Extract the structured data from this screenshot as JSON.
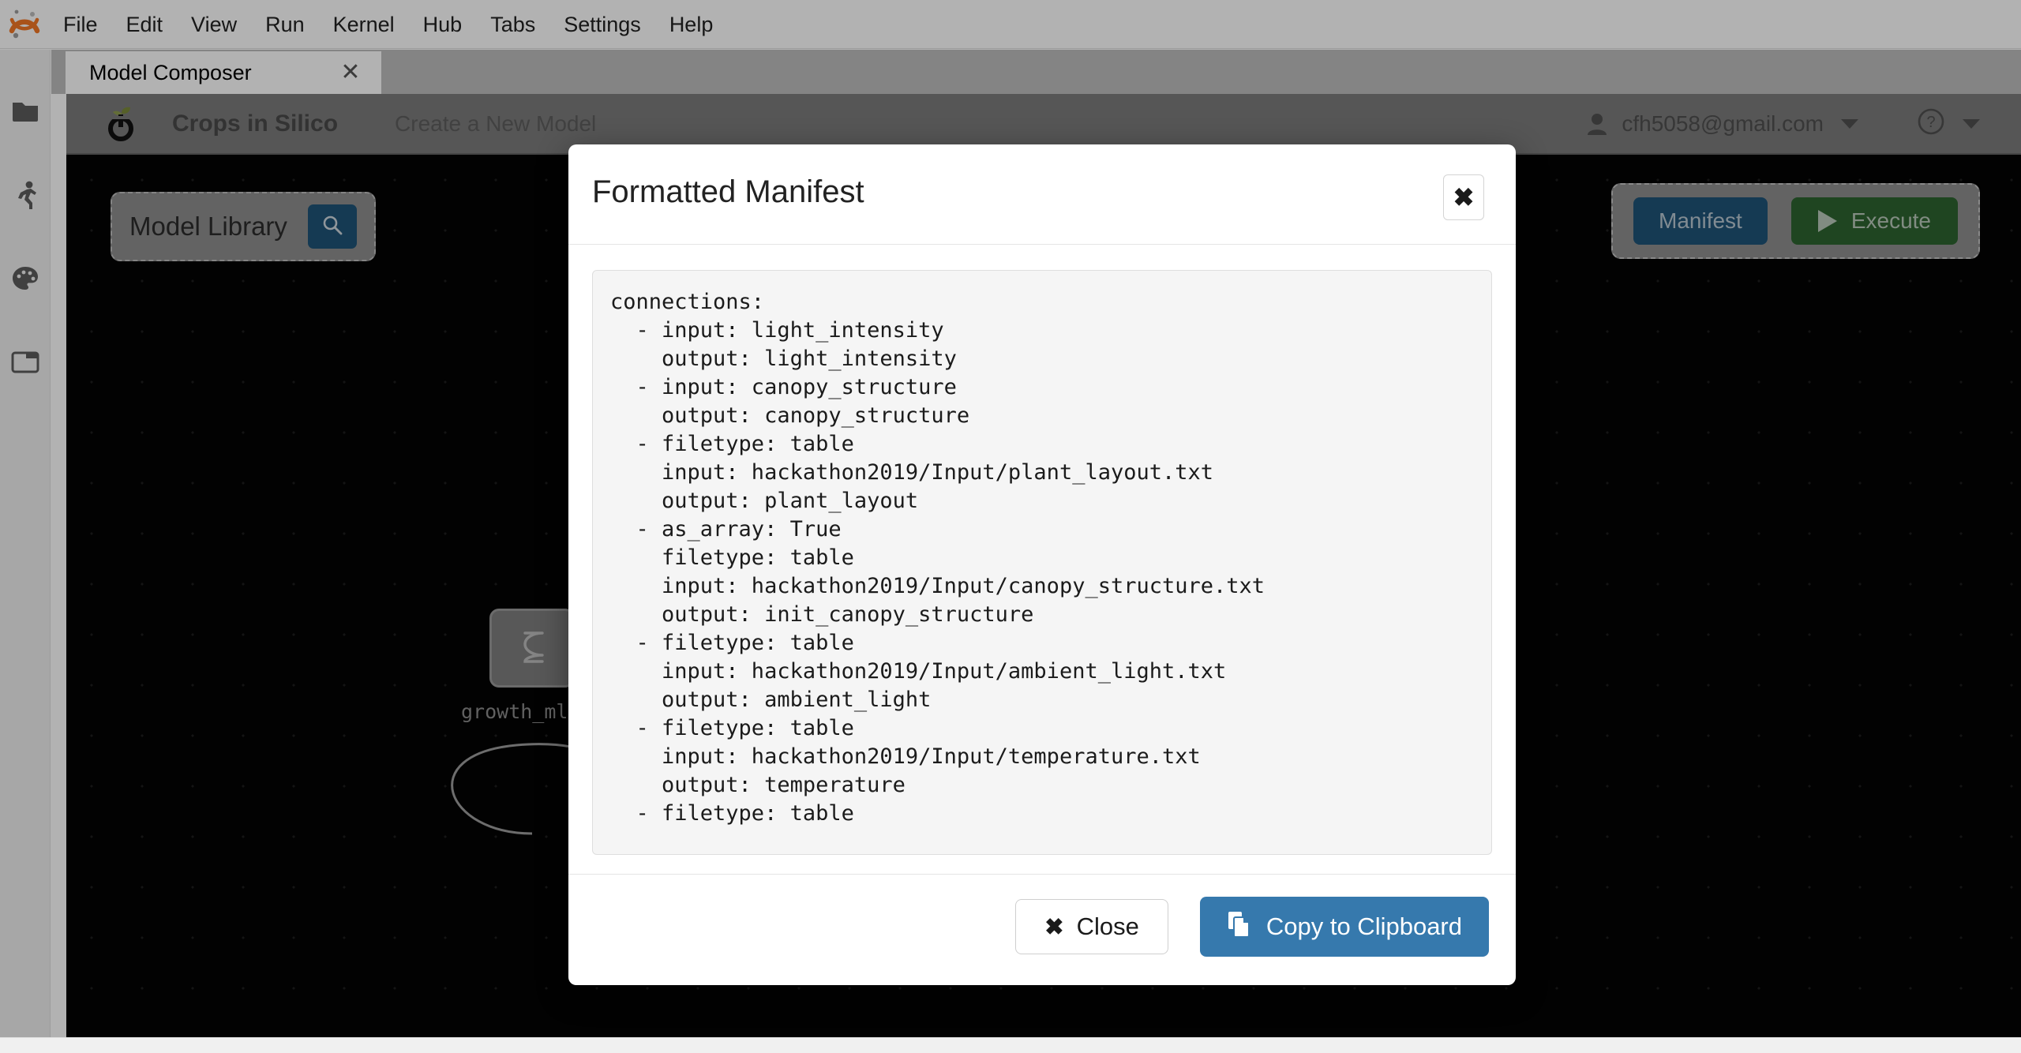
{
  "menubar": {
    "logo_icon": "jupyter-logo",
    "items": [
      {
        "label": "File"
      },
      {
        "label": "Edit"
      },
      {
        "label": "View"
      },
      {
        "label": "Run"
      },
      {
        "label": "Kernel"
      },
      {
        "label": "Hub"
      },
      {
        "label": "Tabs"
      },
      {
        "label": "Settings"
      },
      {
        "label": "Help"
      }
    ]
  },
  "sidebar": {
    "items": [
      {
        "icon": "folder-icon",
        "name": "file-browser"
      },
      {
        "icon": "running-man-icon",
        "name": "running-terminals"
      },
      {
        "icon": "palette-icon",
        "name": "extension-manager"
      },
      {
        "icon": "open-tabs-icon",
        "name": "open-tabs"
      }
    ]
  },
  "tabbar": {
    "active_tab": "Model Composer",
    "close_glyph": "✕"
  },
  "app": {
    "brand": "Crops in Silico",
    "brand_logo_icon": "sprout-power-icon",
    "nav_link": "Create a New Model",
    "user": {
      "icon": "person-icon",
      "email": "cfh5058@gmail.com"
    },
    "help": {
      "icon": "question-circle-icon"
    }
  },
  "canvas": {
    "library_panel": {
      "title": "Model Library",
      "search_icon": "search-icon"
    },
    "actions": {
      "manifest_label": "Manifest",
      "execute_label": "Execute",
      "execute_icon": "play-icon"
    },
    "nodes": [
      {
        "label": "growth_mlang",
        "icon": "model-block-icon"
      }
    ]
  },
  "modal": {
    "title": "Formatted Manifest",
    "close_glyph": "✖",
    "manifest_text": "connections:\n  - input: light_intensity\n    output: light_intensity\n  - input: canopy_structure\n    output: canopy_structure\n  - filetype: table\n    input: hackathon2019/Input/plant_layout.txt\n    output: plant_layout\n  - as_array: True\n    filetype: table\n    input: hackathon2019/Input/canopy_structure.txt\n    output: init_canopy_structure\n  - filetype: table\n    input: hackathon2019/Input/ambient_light.txt\n    output: ambient_light\n  - filetype: table\n    input: hackathon2019/Input/temperature.txt\n    output: temperature\n  - filetype: table",
    "footer": {
      "close_label": "Close",
      "close_icon": "x-icon",
      "copy_label": "Copy to Clipboard",
      "copy_icon": "clipboard-icon"
    }
  },
  "colors": {
    "jupyter_orange": "#F37726",
    "primary_blue": "#3679ad",
    "search_blue": "#1f5377",
    "execute_green": "#2d6430",
    "navbar_gray": "#7b7b7b",
    "canvas_black": "#040404"
  }
}
